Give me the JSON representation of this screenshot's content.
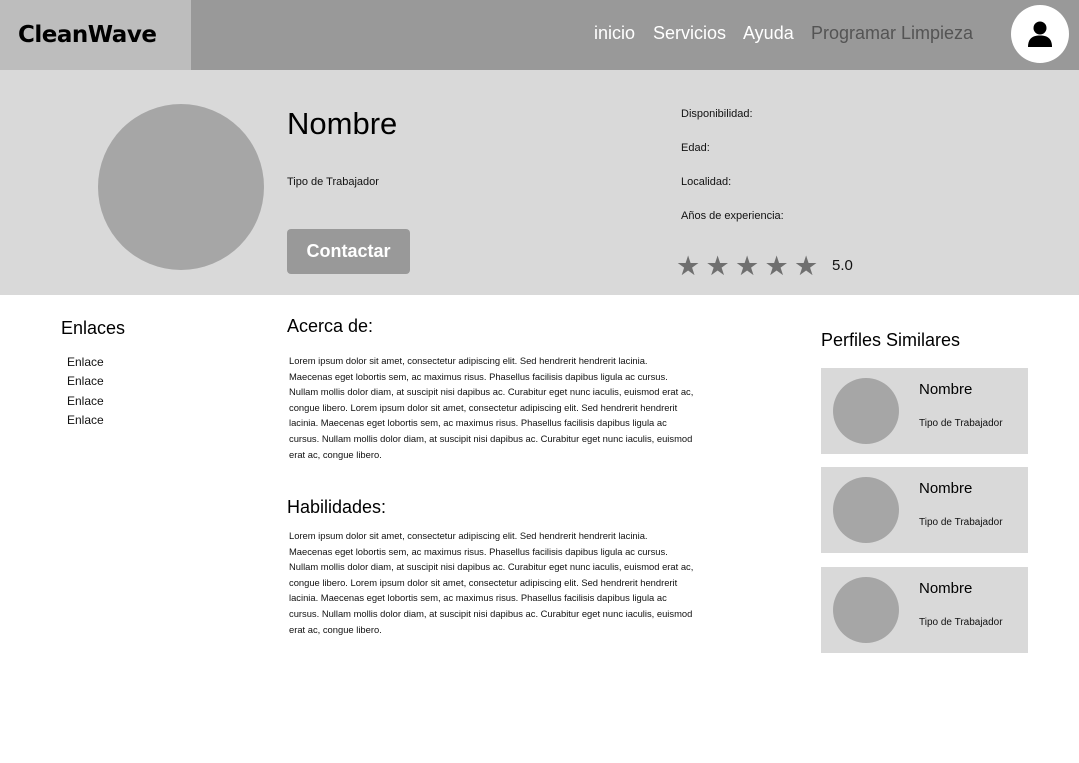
{
  "header": {
    "logo": "CleanWave",
    "nav": {
      "inicio": "inicio",
      "servicios": "Servicios",
      "ayuda": "Ayuda",
      "programar": "Programar Limpieza"
    },
    "user_icon": "user-icon"
  },
  "profile": {
    "name": "Nombre",
    "type": "Tipo de Trabajador",
    "contact_label": "Contactar",
    "details": {
      "availability": "Disponibilidad:",
      "age": "Edad:",
      "location": "Localidad:",
      "experience": "Años de experiencia:"
    },
    "stars": [
      "★",
      "★",
      "★",
      "★",
      "★"
    ],
    "rating": "5.0"
  },
  "links": {
    "title": "Enlaces",
    "items": [
      "Enlace",
      "Enlace",
      "Enlace",
      "Enlace"
    ]
  },
  "about": {
    "title": "Acerca de:",
    "lines": [
      "Lorem ipsum dolor sit amet, consectetur adipiscing elit. Sed hendrerit hendrerit lacinia.",
      "Maecenas eget lobortis sem, ac maximus risus. Phasellus facilisis dapibus ligula ac cursus.",
      "Nullam mollis dolor diam, at suscipit nisi dapibus ac. Curabitur eget nunc iaculis, euismod erat ac,",
      "congue libero. Lorem ipsum dolor sit amet, consectetur adipiscing elit. Sed hendrerit hendrerit",
      "lacinia. Maecenas eget lobortis sem, ac maximus risus. Phasellus facilisis dapibus ligula ac",
      "cursus. Nullam mollis dolor diam, at suscipit nisi dapibus ac. Curabitur eget nunc iaculis, euismod",
      "erat ac, congue libero."
    ]
  },
  "skills": {
    "title": "Habilidades:",
    "lines": [
      "Lorem ipsum dolor sit amet, consectetur adipiscing elit. Sed hendrerit hendrerit lacinia.",
      "Maecenas eget lobortis sem, ac maximus risus. Phasellus facilisis dapibus ligula ac cursus.",
      "Nullam mollis dolor diam, at suscipit nisi dapibus ac. Curabitur eget nunc iaculis, euismod erat ac,",
      "congue libero. Lorem ipsum dolor sit amet, consectetur adipiscing elit. Sed hendrerit hendrerit",
      "lacinia. Maecenas eget lobortis sem, ac maximus risus. Phasellus facilisis dapibus ligula ac",
      "cursus. Nullam mollis dolor diam, at suscipit nisi dapibus ac. Curabitur eget nunc iaculis, euismod",
      "erat ac, congue libero."
    ]
  },
  "similar": {
    "title": "Perfiles Similares",
    "cards": [
      {
        "name": "Nombre",
        "type": "Tipo de Trabajador"
      },
      {
        "name": "Nombre",
        "type": "Tipo de Trabajador"
      },
      {
        "name": "Nombre",
        "type": "Tipo de Trabajador"
      }
    ]
  }
}
